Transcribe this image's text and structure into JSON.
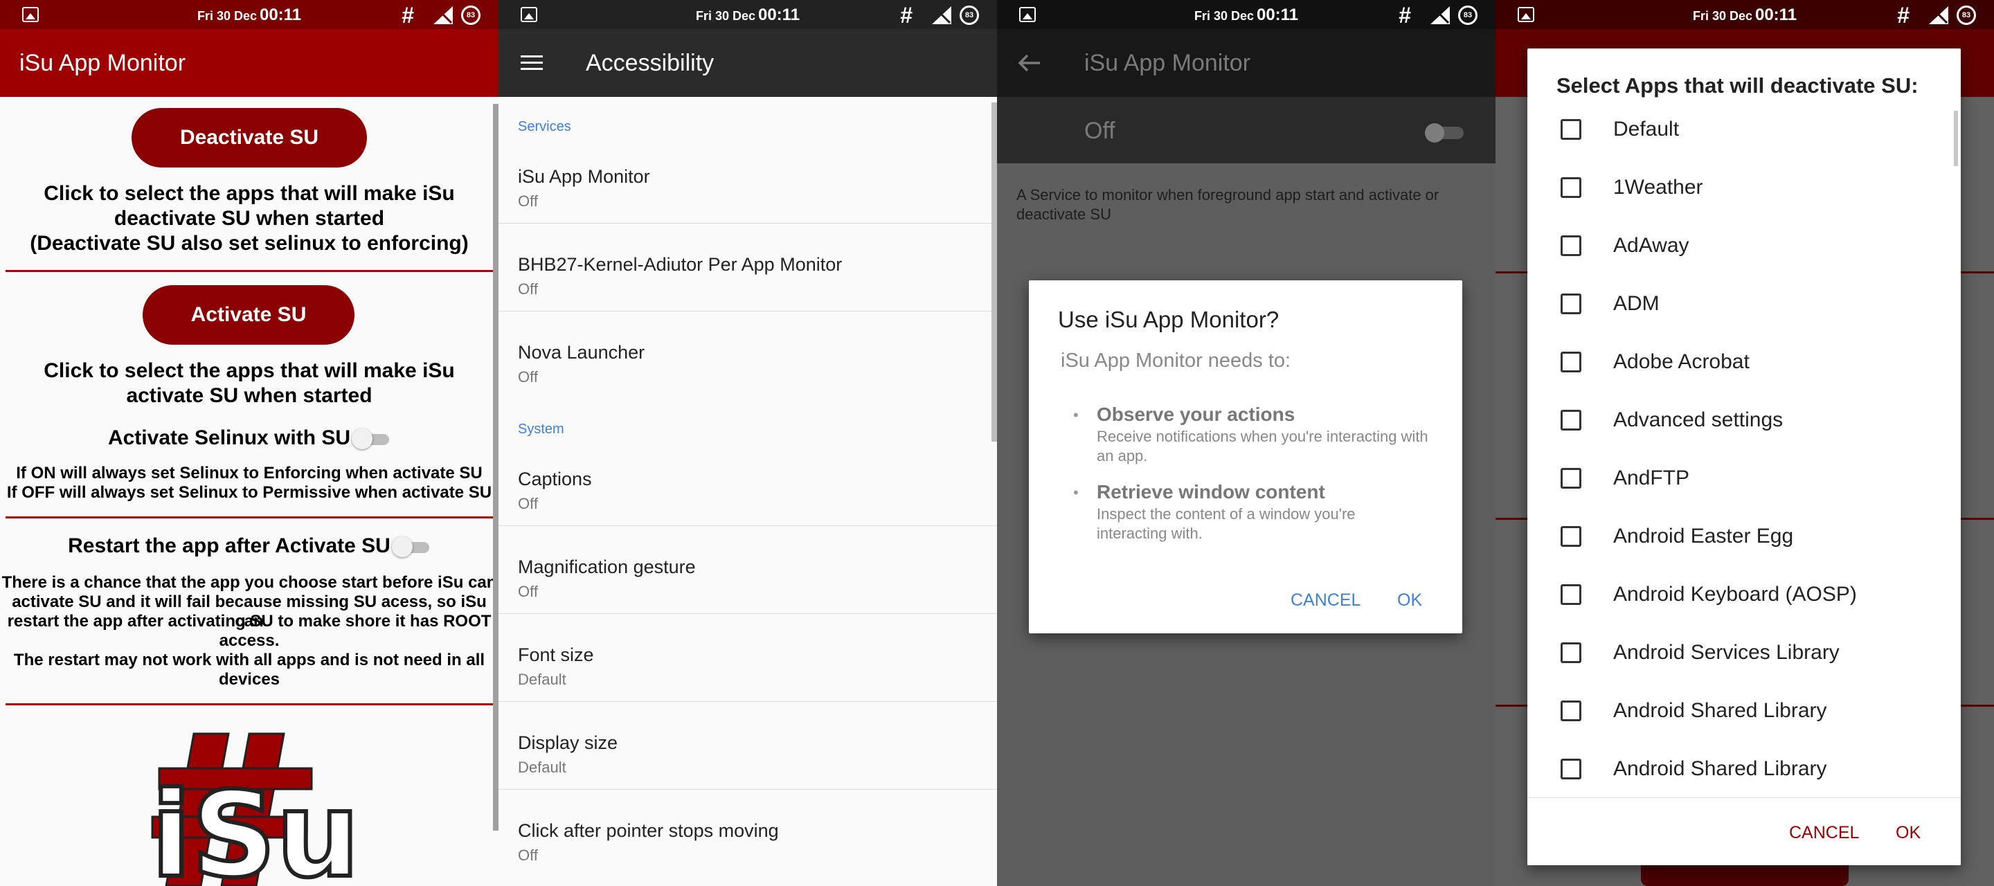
{
  "status": {
    "date": "Fri 30 Dec",
    "time": "00:11",
    "hash": "#",
    "battery": "83"
  },
  "screen1": {
    "app_title": "iSu App Monitor",
    "deactivate_label": "Deactivate SU",
    "deactivate_desc_1": "Click to select the apps that will make iSu",
    "deactivate_desc_2": "deactivate SU when started",
    "deactivate_desc_3": "(Deactivate SU also set selinux to enforcing)",
    "activate_label": "Activate SU",
    "activate_desc_1": "Click to select the apps that will make iSu",
    "activate_desc_2": "activate SU when started",
    "selinux_label": "Activate Selinux with SU",
    "selinux_on": false,
    "selinux_info_1": "If ON will always set Selinux to Enforcing when activate SU",
    "selinux_info_2": "If OFF will always set Selinux to Permissive when activate SU",
    "restart_label": "Restart the app after Activate SU",
    "restart_on": false,
    "restart_info_1": "There is a chance that the app you choose start before iSu can",
    "restart_info_2": "activate SU and it will fail because missing SU acess, so iSu can",
    "restart_info_3": "restart the app after activating SU to make shore it has ROOT",
    "restart_info_4": "access.",
    "restart_info_5": "The restart may not work with all apps and is not need in all",
    "restart_info_6": "devices",
    "logo_text": "iSu"
  },
  "screen2": {
    "title": "Accessibility",
    "sections": [
      {
        "header": "Services",
        "items": [
          {
            "title": "iSu App Monitor",
            "sub": "Off"
          },
          {
            "title": "BHB27-Kernel-Adiutor Per App Monitor",
            "sub": "Off"
          },
          {
            "title": "Nova Launcher",
            "sub": "Off"
          }
        ]
      },
      {
        "header": "System",
        "items": [
          {
            "title": "Captions",
            "sub": "Off"
          },
          {
            "title": "Magnification gesture",
            "sub": "Off"
          },
          {
            "title": "Font size",
            "sub": "Default"
          },
          {
            "title": "Display size",
            "sub": "Default"
          },
          {
            "title": "Click after pointer stops moving",
            "sub": "Off"
          }
        ]
      }
    ]
  },
  "screen3": {
    "title": "iSu App Monitor",
    "switch_label": "Off",
    "description": "A Service to monitor when foreground app start and activate or deactivate SU",
    "dialog": {
      "title": "Use iSu App Monitor?",
      "subtitle": "iSu App Monitor needs to:",
      "b1_title": "Observe your actions",
      "b1_text": "Receive notifications when you're interacting with an app.",
      "b2_title": "Retrieve window content",
      "b2_text": "Inspect the content of a window you're interacting with.",
      "cancel": "CANCEL",
      "ok": "OK"
    }
  },
  "screen4": {
    "dialog_title": "Select Apps that will deactivate SU:",
    "apps": [
      "Default",
      "1Weather",
      "AdAway",
      "ADM",
      "Adobe Acrobat",
      "Advanced settings",
      "AndFTP",
      "Android Easter Egg",
      "Android Keyboard (AOSP)",
      "Android Services Library",
      "Android Shared Library",
      "Android Shared Library"
    ],
    "cancel": "CANCEL",
    "ok": "OK"
  }
}
